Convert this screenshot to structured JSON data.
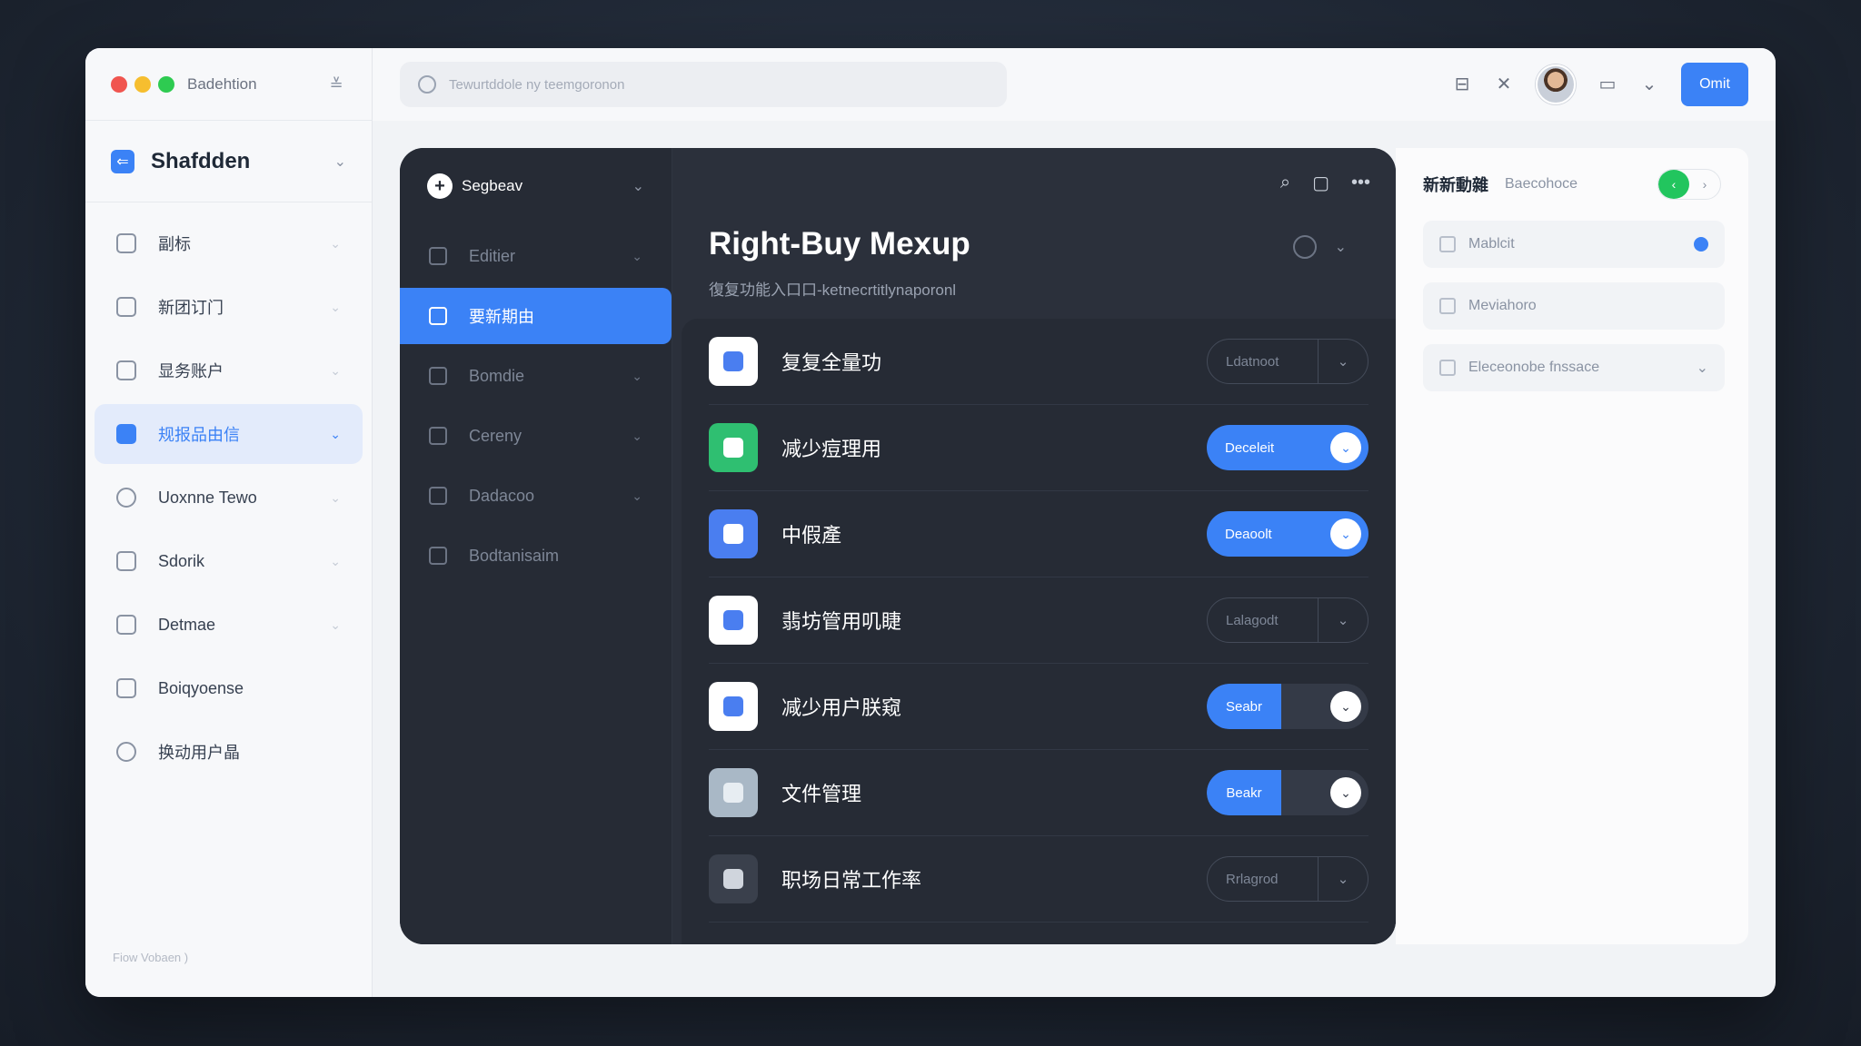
{
  "window": {
    "app_name": "Badehtion"
  },
  "sidebar": {
    "workspace": "Shafdden",
    "items": [
      {
        "label": "副标",
        "active": false
      },
      {
        "label": "新团订门",
        "active": false
      },
      {
        "label": "显务账户",
        "active": false
      },
      {
        "label": "规报品由信",
        "active": true
      },
      {
        "label": "Uoxnne Tewo",
        "active": false
      },
      {
        "label": "Sdorik",
        "active": false
      },
      {
        "label": "Detmae",
        "active": false
      },
      {
        "label": "Boiqyoense",
        "active": false
      },
      {
        "label": "换动用户晶",
        "active": false
      }
    ],
    "footer": "Fiow Vobaen )"
  },
  "topbar": {
    "search_placeholder": "Tewurtddole ny teemgoronon",
    "button_label": "Omit"
  },
  "dark_sidebar": {
    "header": "Segbeav",
    "items": [
      {
        "label": "Editier",
        "active": false
      },
      {
        "label": "要新期由",
        "active": true
      },
      {
        "label": "Bomdie",
        "active": false
      },
      {
        "label": "Cereny",
        "active": false
      },
      {
        "label": "Dadacoo",
        "active": false
      },
      {
        "label": "Bodtanisaim",
        "active": false
      }
    ]
  },
  "main": {
    "title": "Right-Buy Mexup",
    "subtitle": "復复功能入口口-ketnecrtitlynaporonl",
    "rows": [
      {
        "name": "复复全量功",
        "control": "Ldatnoot",
        "state": "off",
        "icon_color": "#4a7ef0"
      },
      {
        "name": "减少痘理用",
        "control": "Deceleit",
        "state": "on",
        "icon_color": "#2fbf71"
      },
      {
        "name": "中假產",
        "control": "Deaoolt",
        "state": "on",
        "icon_color": "#4a7ef0"
      },
      {
        "name": "翡坊管用叽睫",
        "control": "Lalagodt",
        "state": "off",
        "icon_color": "#4a7ef0"
      },
      {
        "name": "减少用户朕窥",
        "control": "Seabr",
        "state": "split",
        "icon_color": "#4a7ef0"
      },
      {
        "name": "文件管理",
        "control": "Beakr",
        "state": "split",
        "icon_color": "#a9b8c6"
      },
      {
        "name": "职场日常工作率",
        "control": "Rrlagrod",
        "state": "off",
        "icon_color": "#3a404c"
      }
    ]
  },
  "right_panel": {
    "title": "新新動雜",
    "subtitle": "Baecohoce",
    "fields": [
      {
        "label": "Mablcit"
      },
      {
        "label": "Meviahoro"
      },
      {
        "label": "Eleceonobe fnssace"
      }
    ]
  },
  "colors": {
    "accent": "#3b82f6",
    "green": "#22c55e",
    "dark_panel": "#262b35"
  }
}
